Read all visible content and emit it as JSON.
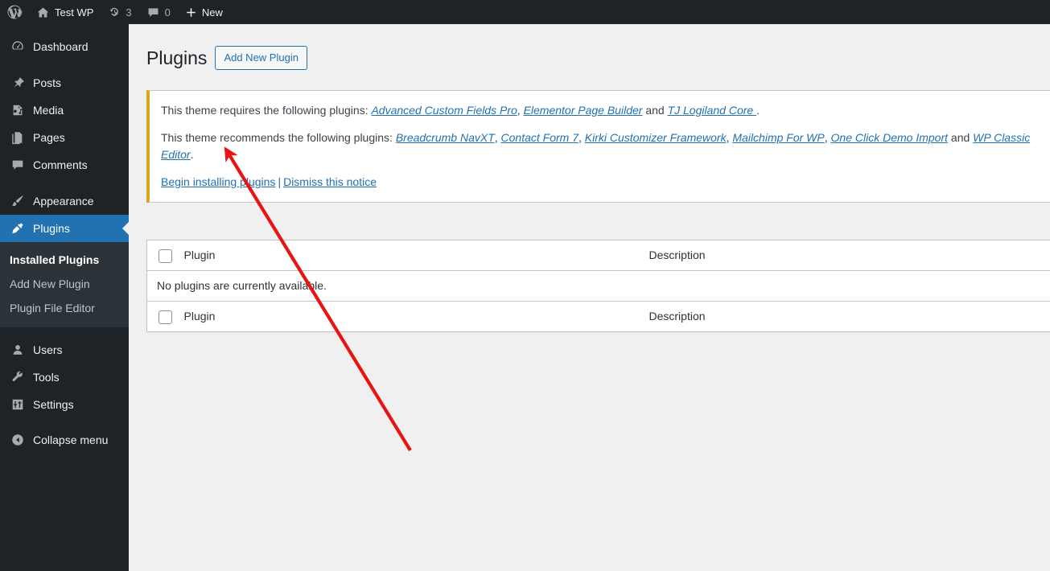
{
  "adminbar": {
    "logo_icon": "wordpress-logo-icon",
    "site_name": "Test WP",
    "home_icon": "home-icon",
    "updates_icon": "updates-icon",
    "updates_count": "3",
    "comments_icon": "comment-bubble-icon",
    "comments_count": "0",
    "new_icon": "plus-icon",
    "new_label": "New"
  },
  "sidebar": {
    "items": [
      {
        "label": "Dashboard",
        "icon": "dashboard-icon",
        "current": false
      },
      {
        "label": "Posts",
        "icon": "pin-icon",
        "current": false
      },
      {
        "label": "Media",
        "icon": "media-icon",
        "current": false
      },
      {
        "label": "Pages",
        "icon": "pages-icon",
        "current": false
      },
      {
        "label": "Comments",
        "icon": "comment-bubble-icon",
        "current": false
      },
      {
        "label": "Appearance",
        "icon": "paintbrush-icon",
        "current": false
      },
      {
        "label": "Plugins",
        "icon": "plug-icon",
        "current": true
      },
      {
        "label": "Users",
        "icon": "user-icon",
        "current": false
      },
      {
        "label": "Tools",
        "icon": "wrench-icon",
        "current": false
      },
      {
        "label": "Settings",
        "icon": "settings-sliders-icon",
        "current": false
      }
    ],
    "submenu": [
      {
        "label": "Installed Plugins",
        "current": true
      },
      {
        "label": "Add New Plugin",
        "current": false
      },
      {
        "label": "Plugin File Editor",
        "current": false
      }
    ],
    "collapse": {
      "label": "Collapse menu",
      "icon": "collapse-arrow-icon"
    },
    "accent_color": "#2271b1",
    "background_color": "#1d2327",
    "submenu_background_color": "#2c3338"
  },
  "page": {
    "title": "Plugins",
    "add_new_button": "Add New Plugin"
  },
  "notice": {
    "border_color": "#dba617",
    "required_prefix": "This theme requires the following plugins:",
    "required_plugins": [
      "Advanced Custom Fields Pro",
      "Elementor Page Builder",
      "TJ Logiland Core "
    ],
    "recommended_prefix": "This theme recommends the following plugins:",
    "recommended_plugins": [
      "Breadcrumb NavXT",
      "Contact Form 7",
      "Kirki Customizer Framework",
      "Mailchimp For WP",
      "One Click Demo Import",
      "WP Classic Editor"
    ],
    "conjunction": "and",
    "comma": ",",
    "period": ".",
    "begin_installing": "Begin installing plugins",
    "separator": "|",
    "dismiss": "Dismiss this notice"
  },
  "table": {
    "columns": {
      "plugin": "Plugin",
      "description": "Description"
    },
    "empty_message": "No plugins are currently available."
  },
  "annotation": {
    "arrow_color": "#e81313"
  }
}
